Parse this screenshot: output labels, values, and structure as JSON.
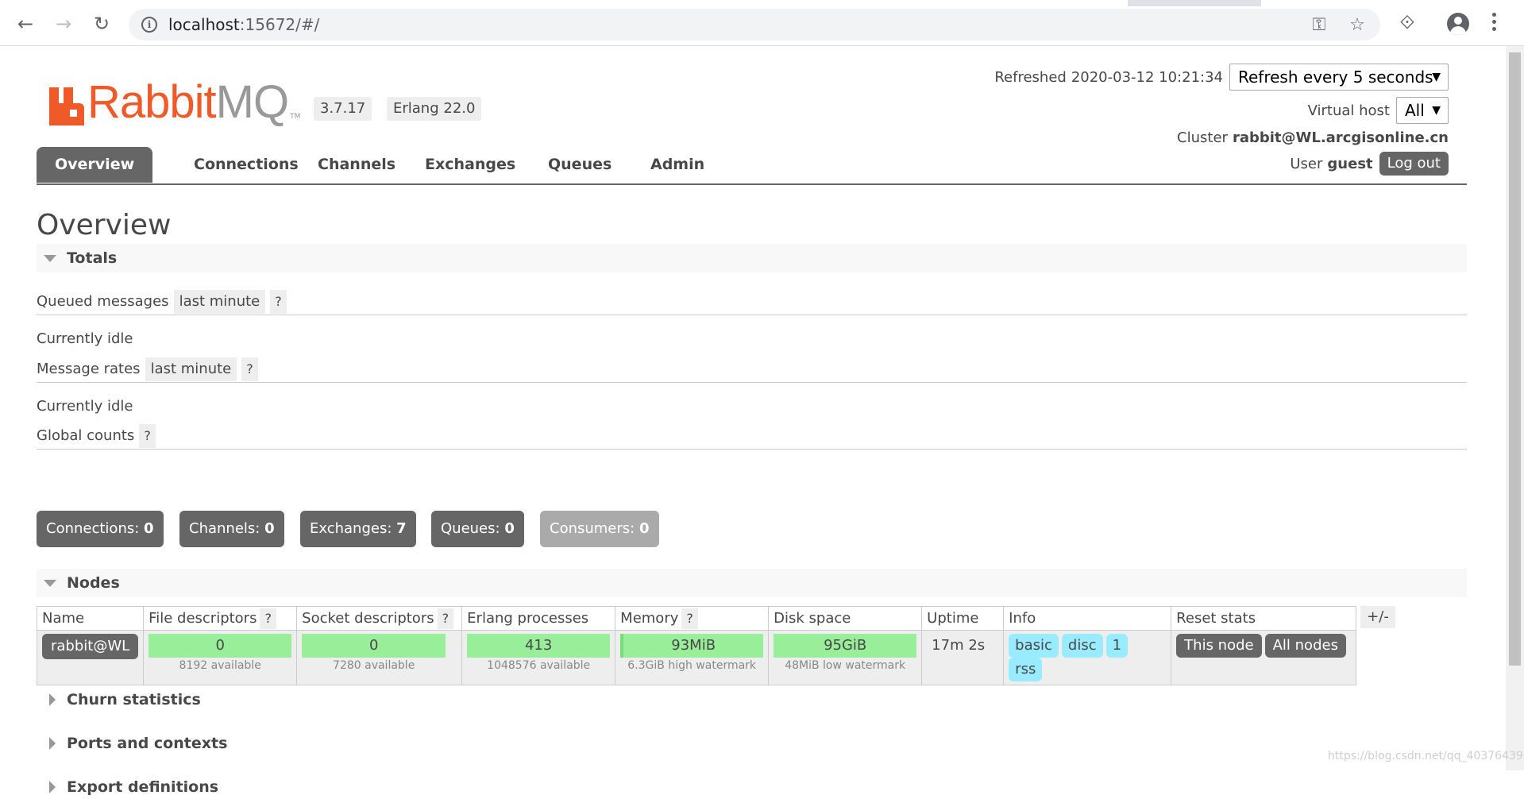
{
  "browser": {
    "url_host": "localhost",
    "url_path": ":15672/#/"
  },
  "logo": {
    "rabbit": "Rabbit",
    "mq": "MQ",
    "tm": "TM"
  },
  "versions": {
    "rabbitmq": "3.7.17",
    "erlang": "Erlang 22.0"
  },
  "header": {
    "refreshed_label": "Refreshed",
    "refreshed_value": "2020-03-12 10:21:34",
    "refresh_select": "Refresh every 5 seconds",
    "vhost_label": "Virtual host",
    "vhost_select": "All",
    "cluster_label": "Cluster",
    "cluster_value": "rabbit@WL.arcgisonline.cn",
    "user_label": "User",
    "user_value": "guest",
    "logout_label": "Log out"
  },
  "tabs": [
    {
      "label": "Overview",
      "active": true
    },
    {
      "label": "Connections"
    },
    {
      "label": "Channels"
    },
    {
      "label": "Exchanges"
    },
    {
      "label": "Queues"
    },
    {
      "label": "Admin"
    }
  ],
  "page_title": "Overview",
  "totals": {
    "title": "Totals",
    "queued_label": "Queued messages",
    "queued_range": "last minute",
    "help": "?",
    "queued_status": "Currently idle",
    "rates_label": "Message rates",
    "rates_range": "last minute",
    "rates_status": "Currently idle",
    "global_label": "Global counts",
    "counts": [
      {
        "label": "Connections:",
        "value": "0"
      },
      {
        "label": "Channels:",
        "value": "0"
      },
      {
        "label": "Exchanges:",
        "value": "7"
      },
      {
        "label": "Queues:",
        "value": "0"
      },
      {
        "label": "Consumers:",
        "value": "0"
      }
    ]
  },
  "nodes": {
    "title": "Nodes",
    "columns": [
      "Name",
      "File descriptors",
      "Socket descriptors",
      "Erlang processes",
      "Memory",
      "Disk space",
      "Uptime",
      "Info",
      "Reset stats"
    ],
    "row": {
      "name": "rabbit@WL",
      "file_descriptors": "0",
      "file_descriptors_sub": "8192 available",
      "socket_descriptors": "0",
      "socket_descriptors_sub": "7280 available",
      "erlang_processes": "413",
      "erlang_processes_sub": "1048576 available",
      "memory": "93MiB",
      "memory_sub": "6.3GiB high watermark",
      "disk": "95GiB",
      "disk_sub": "48MiB low watermark",
      "uptime": "17m 2s",
      "info": [
        "basic",
        "disc",
        "1",
        "rss"
      ],
      "reset_this": "This node",
      "reset_all": "All nodes"
    },
    "plus_minus": "+/-"
  },
  "collapsed_sections": [
    "Churn statistics",
    "Ports and contexts",
    "Export definitions"
  ],
  "watermark": "https://blog.csdn.net/qq_40376439"
}
